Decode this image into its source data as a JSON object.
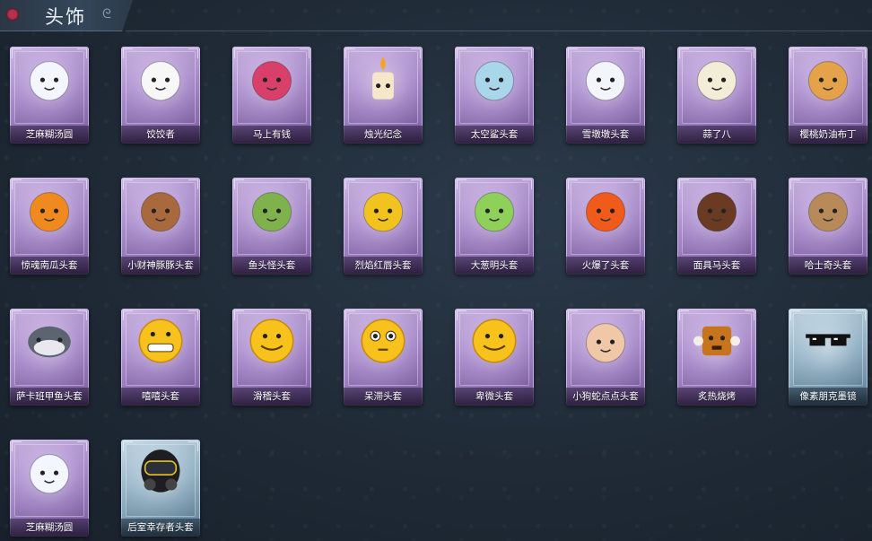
{
  "header": {
    "title": "头饰"
  },
  "items": [
    {
      "label": "芝麻糊汤圆",
      "rarity": "purple",
      "icon": "tangyuan-flower-icon",
      "color": "#f4f6ff"
    },
    {
      "label": "饺饺者",
      "rarity": "purple",
      "icon": "dumpling-cloud-icon",
      "color": "#f7f7f7"
    },
    {
      "label": "马上有钱",
      "rarity": "purple",
      "icon": "pink-horse-icon",
      "color": "#d8406a"
    },
    {
      "label": "烛光纪念",
      "rarity": "purple",
      "icon": "candle-icon",
      "color": "#f5e7c8"
    },
    {
      "label": "太空鲨头套",
      "rarity": "purple",
      "icon": "shark-head-icon",
      "color": "#a9d6ea"
    },
    {
      "label": "雪墩墩头套",
      "rarity": "purple",
      "icon": "snowman-head-icon",
      "color": "#f2f5fa"
    },
    {
      "label": "蒜了八",
      "rarity": "purple",
      "icon": "garlic-head-icon",
      "color": "#f3ecd6"
    },
    {
      "label": "樱桃奶油布丁",
      "rarity": "purple",
      "icon": "pudding-head-icon",
      "color": "#e4a24a"
    },
    {
      "label": "惊魂南瓜头套",
      "rarity": "purple",
      "icon": "pumpkin-head-icon",
      "color": "#f08a1e"
    },
    {
      "label": "小财神豚豚头套",
      "rarity": "purple",
      "icon": "pig-head-icon",
      "color": "#a86a3c"
    },
    {
      "label": "鱼头怪头套",
      "rarity": "purple",
      "icon": "fish-head-icon",
      "color": "#7fb24d"
    },
    {
      "label": "烈焰红唇头套",
      "rarity": "purple",
      "icon": "pikachu-head-icon",
      "color": "#f2c21f"
    },
    {
      "label": "大葱明头套",
      "rarity": "purple",
      "icon": "scallion-head-icon",
      "color": "#8fd05a"
    },
    {
      "label": "火爆了头套",
      "rarity": "purple",
      "icon": "fire-head-icon",
      "color": "#f05a1a"
    },
    {
      "label": "面具马头套",
      "rarity": "purple",
      "icon": "horse-mask-icon",
      "color": "#6a3a22"
    },
    {
      "label": "哈士奇头套",
      "rarity": "purple",
      "icon": "husky-head-icon",
      "color": "#b88a5a"
    },
    {
      "label": "萨卡班甲鱼头套",
      "rarity": "purple",
      "icon": "sacabambaspis-icon",
      "color": "#5c6470"
    },
    {
      "label": "嘻嘻头套",
      "rarity": "purple",
      "icon": "grin-emoji-icon",
      "color": "#f7c21b"
    },
    {
      "label": "滑稽头套",
      "rarity": "purple",
      "icon": "funny-emoji-icon",
      "color": "#f7c21b"
    },
    {
      "label": "呆滞头套",
      "rarity": "purple",
      "icon": "dazed-emoji-icon",
      "color": "#f7c21b"
    },
    {
      "label": "卑微头套",
      "rarity": "purple",
      "icon": "humble-emoji-icon",
      "color": "#f7c21b"
    },
    {
      "label": "小狗蛇点点头套",
      "rarity": "purple",
      "icon": "dog-snake-icon",
      "color": "#f0c8a8"
    },
    {
      "label": "炙热烧烤",
      "rarity": "purple",
      "icon": "bbq-meat-icon",
      "color": "#c8741e"
    },
    {
      "label": "像素朋克墨镜",
      "rarity": "blue",
      "icon": "pixel-sunglasses-icon",
      "color": "#111111"
    },
    {
      "label": "芝麻糊汤圆",
      "rarity": "purple",
      "icon": "tangyuan-flower-icon",
      "color": "#f4f6ff"
    },
    {
      "label": "后室幸存者头套",
      "rarity": "blue",
      "icon": "gas-mask-helmet-icon",
      "color": "#1e1e22"
    }
  ]
}
